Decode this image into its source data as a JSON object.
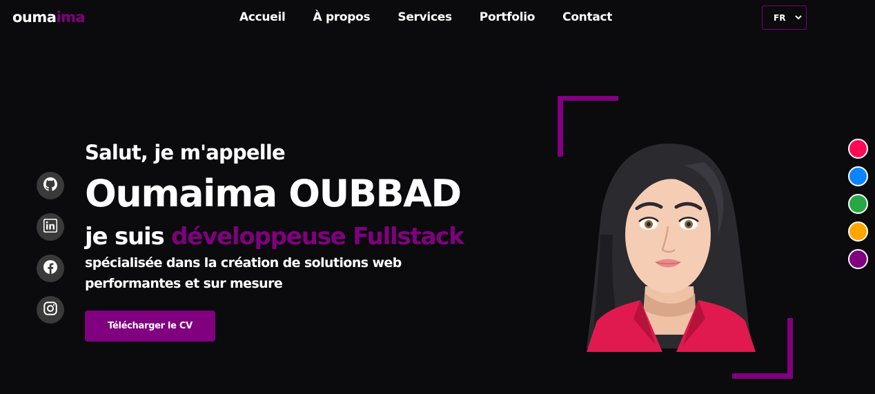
{
  "header": {
    "logo_part1": "ouma",
    "logo_part2": "ima",
    "nav": [
      "Accueil",
      "À propos",
      "Services",
      "Portfolio",
      "Contact"
    ],
    "lang_selected": "FR"
  },
  "social": [
    "github-icon",
    "linkedin-icon",
    "facebook-icon",
    "instagram-icon"
  ],
  "hero": {
    "greeting": "Salut, je m'appelle",
    "name": "Oumaima OUBBAD",
    "role_prefix": "je suis ",
    "role_highlight": "développeuse Fullstack",
    "description": "spécialisée dans la création de solutions web performantes et sur mesure",
    "cta": "Télécharger le CV"
  },
  "theme": {
    "accent": "#800080",
    "background": "#0b0a0c",
    "palette": [
      "#ff0a54",
      "#0a84ff",
      "#28a745",
      "#ffa500",
      "#800080"
    ]
  }
}
